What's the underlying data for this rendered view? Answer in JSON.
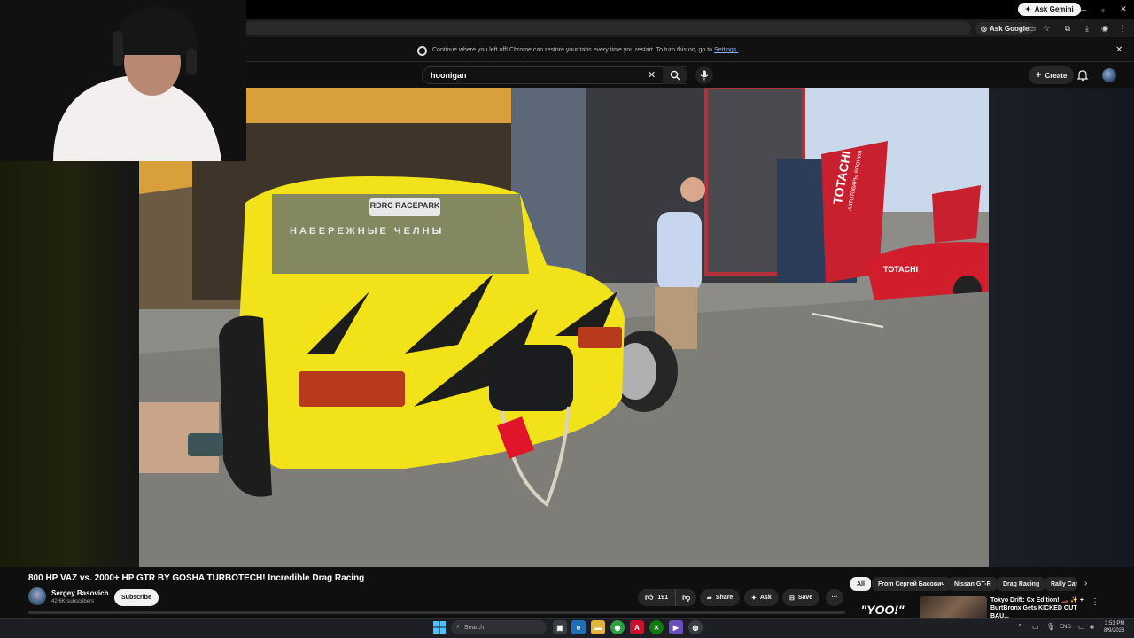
{
  "browser": {
    "ask_gemini": "Ask Gemini",
    "ask_google": "Ask Google",
    "restore_text": "Continue where you left off! Chrome can restore your tabs every time you restart. To turn this on, go to",
    "restore_link": "Settings."
  },
  "youtube": {
    "search_query": "hoonigan",
    "create_label": "Create"
  },
  "video": {
    "title": "800 HP VAZ vs. 2000+ HP GTR BY GOSHA TURBOTECH! Incredible Drag Racing",
    "plate_text": "RDRC RACEPARK",
    "banner_text": "НАБЕРЕЖНЫЕ ЧЕЛНЫ",
    "sponsor": "TOTACHI",
    "sponsor_sub": "АВТОТОВАРЫ ЯПОНИЯ"
  },
  "channel": {
    "name": "Sergey Basovich",
    "subscribers": "42.6K subscribers",
    "subscribe_label": "Subscribe"
  },
  "actions": {
    "likes": "191",
    "share": "Share",
    "ask": "Ask",
    "save": "Save",
    "more": "···"
  },
  "chips": [
    "All",
    "From Сергей Басович",
    "Nissan GT-R",
    "Drag Racing",
    "Rally Car"
  ],
  "recommendation": {
    "thumb_text": "\"YOO!\"",
    "title": "Tokyo Drift: Cx Edition! 🏎️ ✨ + BurtBronx Gets KICKED OUT BAU..."
  },
  "taskbar": {
    "search_placeholder": "Search",
    "lang": "ENG",
    "time": "3:53 PM",
    "date": "8/9/2026"
  }
}
